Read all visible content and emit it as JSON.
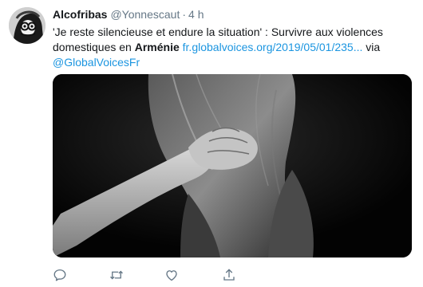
{
  "tweet": {
    "author_name": "Alcofribas",
    "author_handle": "@Yonnescaut",
    "separator": "·",
    "time": "4 h",
    "text_before": "'Je reste silencieuse et endure la situation' : Survivre aux violences domestiques en ",
    "text_bold": "Arménie",
    "text_link": "fr.globalvoices.org/2019/05/01/235...",
    "text_via": " via ",
    "text_mention": "@GlobalVoicesFr"
  },
  "actions": {
    "icons": [
      "reply-icon",
      "retweet-icon",
      "like-icon",
      "share-icon"
    ]
  },
  "colors": {
    "link": "#1b95e0",
    "muted": "#657786",
    "text": "#14171a"
  }
}
